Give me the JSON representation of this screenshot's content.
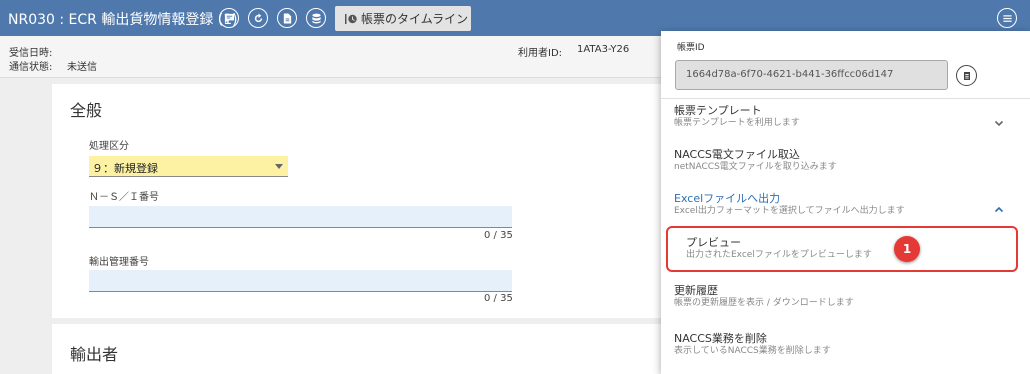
{
  "header": {
    "title": "NR030 : ECR 輸出貨物情報登録 (1)",
    "timeline_label": "帳票のタイムライン"
  },
  "info": {
    "received_label": "受信日時:",
    "status_label": "通信状態:",
    "status_value": "未送信",
    "user_label": "利用者ID:",
    "user_value": "1ATA3-Y26"
  },
  "form": {
    "section_general": "全般",
    "processing_label": "処理区分",
    "processing_value": "９：新規登録",
    "ns_label": "Ｎ－Ｓ／Ｉ番号",
    "ns_counter": "0 / 35",
    "export_mgmt_label": "輸出管理番号",
    "export_counter": "0 / 35",
    "section_exporter": "輸出者"
  },
  "dropdown": {
    "id_label": "帳票ID",
    "id_value": "1664d78a-6f70-4621-b441-36ffcc06d147",
    "items": [
      {
        "label": "帳票テンプレート",
        "sub": "帳票テンプレートを利用します"
      },
      {
        "label": "NACCS電文ファイル取込",
        "sub": "netNACCS電文ファイルを取り込みます"
      },
      {
        "label": "Excelファイルへ出力",
        "sub": "Excel出力フォーマットを選択してファイルへ出力します"
      },
      {
        "label": "プレビュー",
        "sub": "出力されたExcelファイルをプレビューします"
      },
      {
        "label": "更新履歴",
        "sub": "帳票の更新履歴を表示 / ダウンロードします"
      },
      {
        "label": "NACCS業務を削除",
        "sub": "表示しているNACCS業務を削除します"
      }
    ],
    "badge": "1"
  },
  "colors": {
    "header_bg": "#4f79ad",
    "accent": "#2b6fb8",
    "highlight": "#e53935",
    "select_bg": "#fdf2a4",
    "input_bg": "#e6f0fb"
  },
  "icons": [
    "comment-icon",
    "refresh-icon",
    "document-icon",
    "database-icon",
    "timeline-icon",
    "hamburger-menu-icon",
    "copy-icon",
    "chevron-down-icon",
    "chevron-up-icon"
  ]
}
